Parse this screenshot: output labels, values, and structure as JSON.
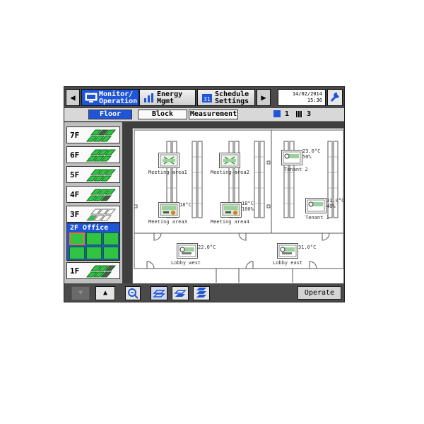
{
  "topbar": {
    "monitor_label": "Monitor/\nOperation",
    "energy_label": "Energy\nMgmt",
    "schedule_label": "Schedule\nSettings",
    "schedule_day": "31",
    "date": "14/02/2014",
    "time": "15:36"
  },
  "tabs": {
    "floor": "Floor",
    "block": "Block",
    "measurement": "Measurement"
  },
  "counts": {
    "a": "1",
    "b": "3"
  },
  "floors": [
    "7F",
    "6F",
    "5F",
    "4F",
    "3F"
  ],
  "selected_floor": "2F Office",
  "last_floor": "1F",
  "units": [
    {
      "label": "Meeting area1",
      "temp": ""
    },
    {
      "label": "Meeting area2",
      "temp": ""
    },
    {
      "label": "Meeting area3",
      "temp": "18°C"
    },
    {
      "label": "Meeting area4",
      "temp": "18°C\n100%"
    },
    {
      "label": "Tenant 2",
      "temp": "23.0°C\n50%"
    },
    {
      "label": "Tenant 1",
      "temp": "31.0°C\n40%"
    },
    {
      "label": "Lobby west",
      "temp": "22.0°C"
    },
    {
      "label": "Lobby east",
      "temp": "31.0°C"
    }
  ],
  "operate_label": "Operate",
  "colors": {
    "accent": "#1f55d6",
    "green": "#31c443"
  }
}
